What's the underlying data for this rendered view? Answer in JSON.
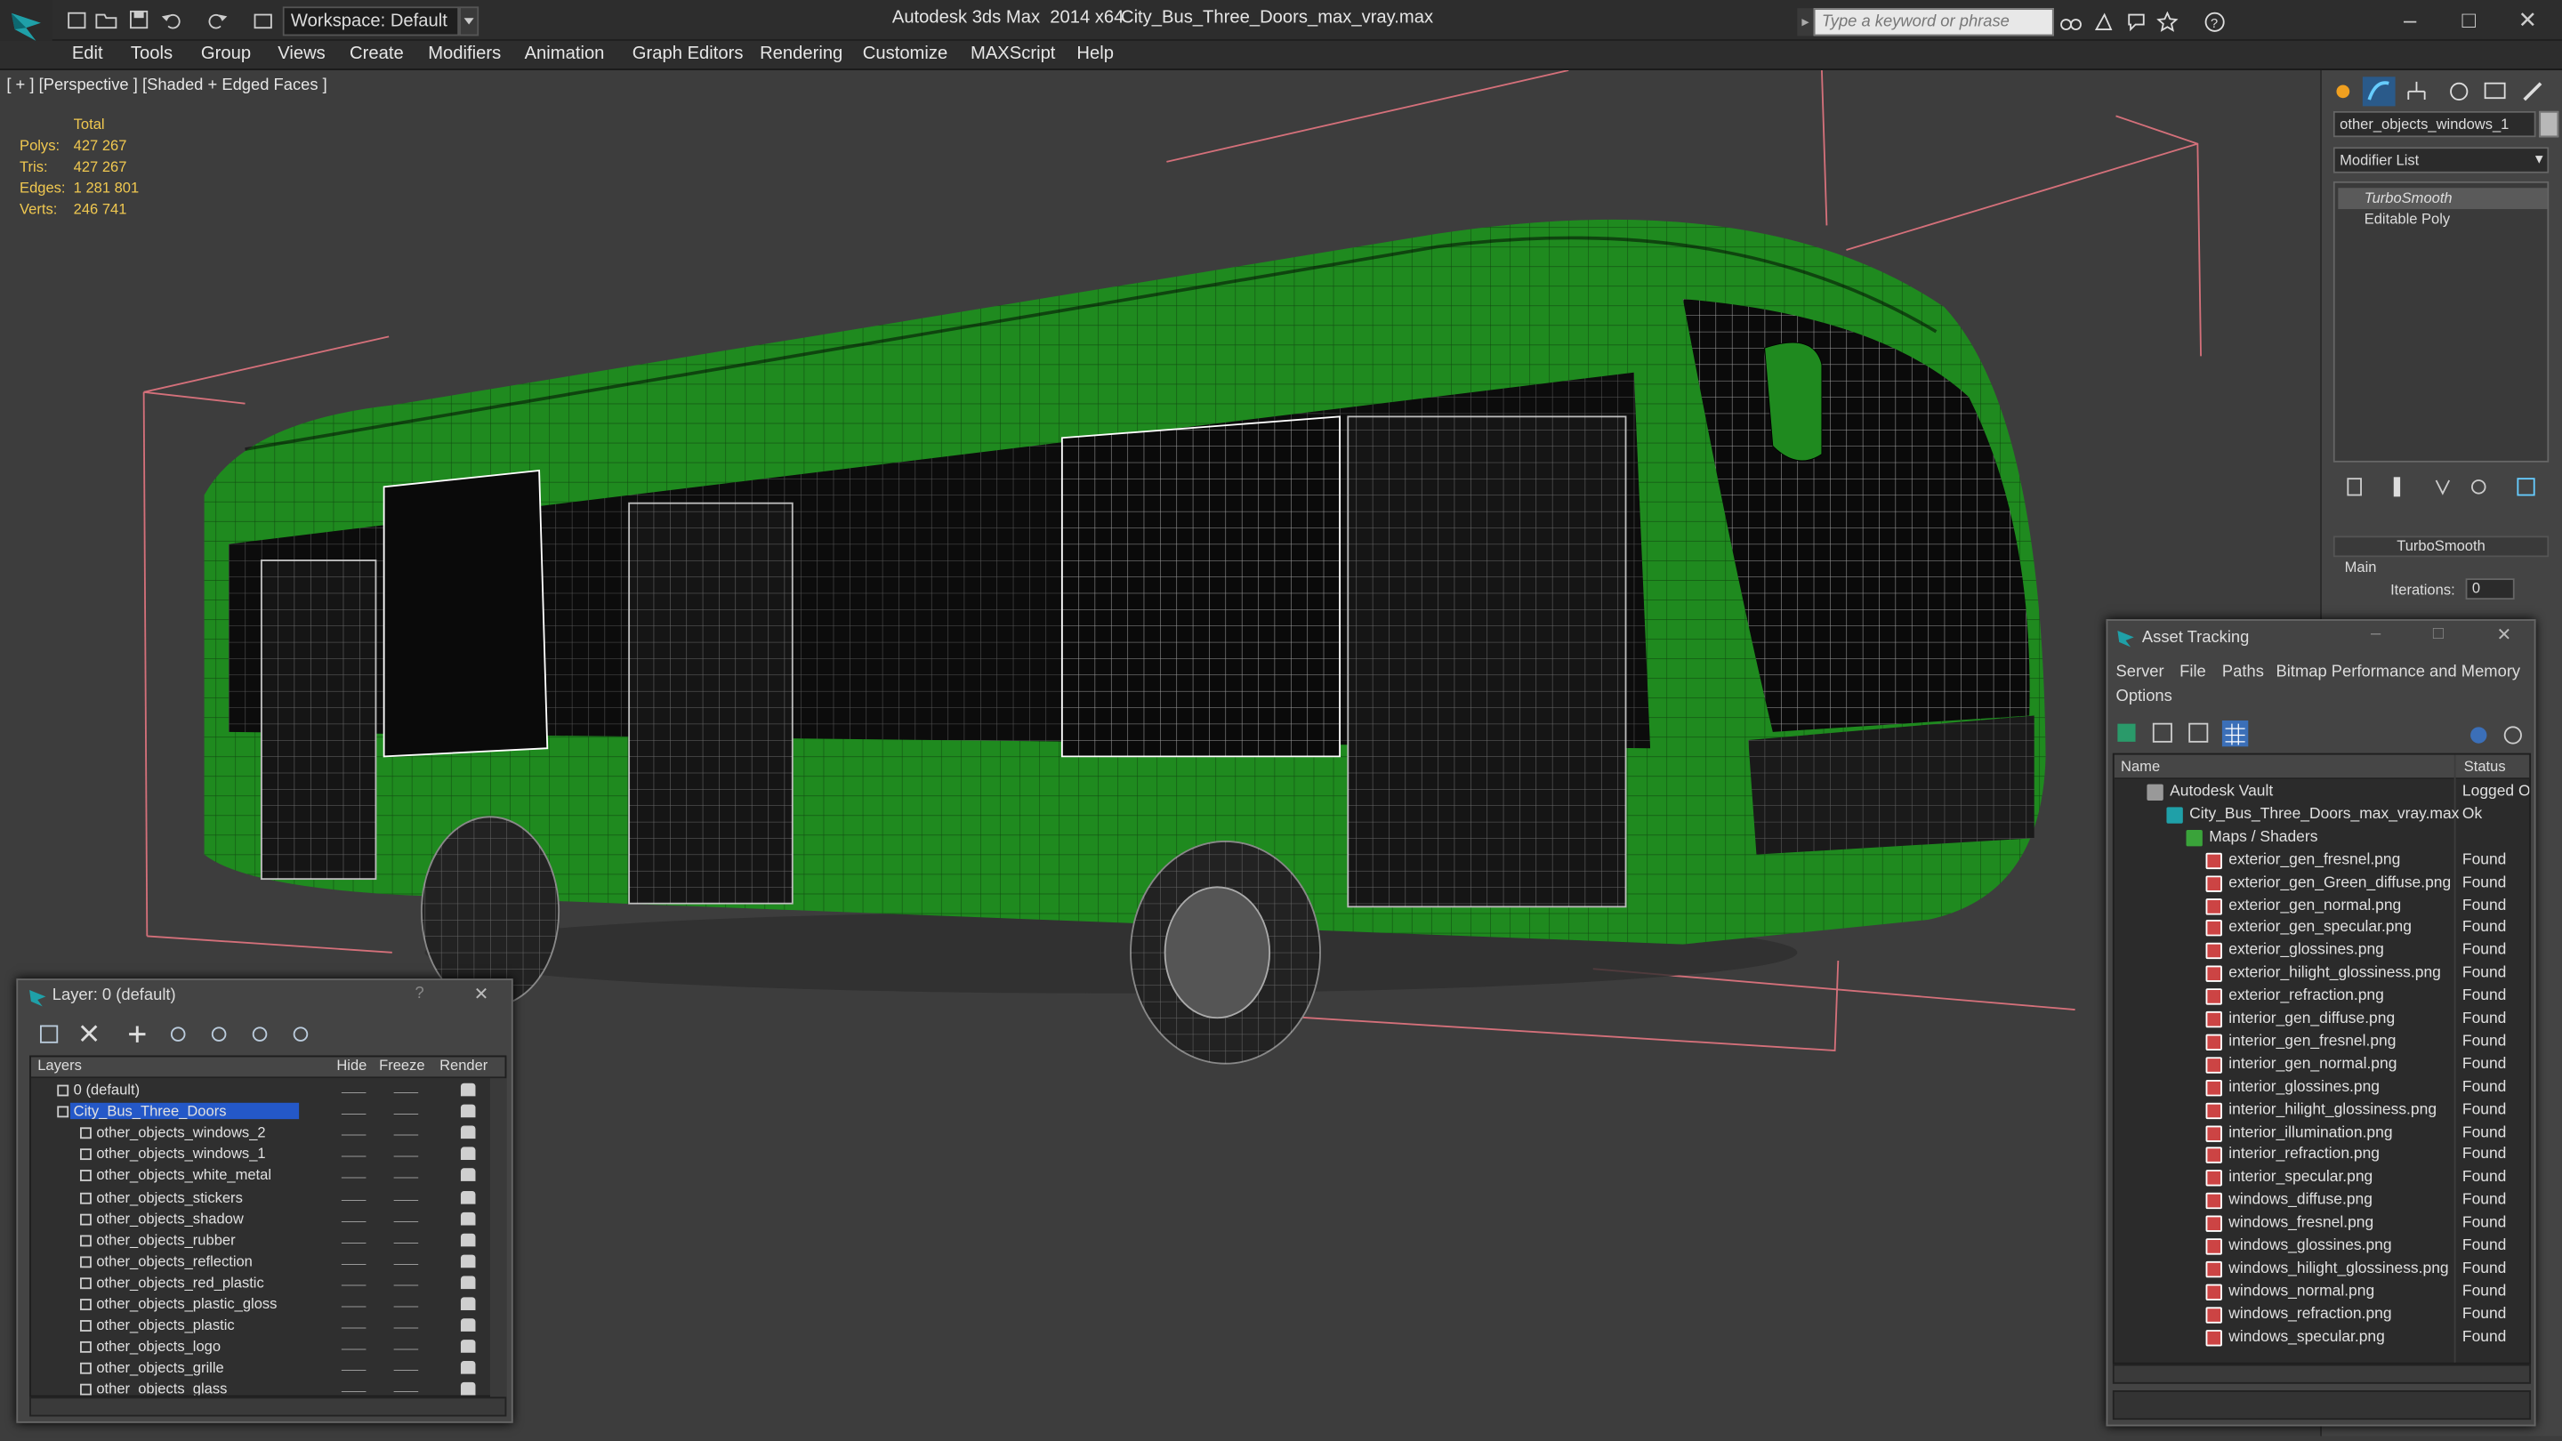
{
  "app": {
    "title": "Autodesk 3ds Max  2014 x64",
    "file": "City_Bus_Three_Doors_max_vray.max",
    "workspace": "Workspace: Default",
    "search_placeholder": "Type a keyword or phrase"
  },
  "menu": [
    "Edit",
    "Tools",
    "Group",
    "Views",
    "Create",
    "Modifiers",
    "Animation",
    "Graph Editors",
    "Rendering",
    "Customize",
    "MAXScript",
    "Help"
  ],
  "viewport": {
    "label": "[ + ] [Perspective ] [Shaded + Edged Faces ]",
    "stats": {
      "header": "Total",
      "rows": [
        {
          "label": "Polys:",
          "value": "427 267"
        },
        {
          "label": "Tris:",
          "value": "427 267"
        },
        {
          "label": "Edges:",
          "value": "1 281 801"
        },
        {
          "label": "Verts:",
          "value": "246 741"
        }
      ]
    }
  },
  "command_panel": {
    "object_name": "other_objects_windows_1",
    "modifier_list": "Modifier List",
    "stack": [
      "TurboSmooth",
      "Editable Poly"
    ],
    "rollout_title": "TurboSmooth",
    "main_label": "Main",
    "iterations_label": "Iterations:",
    "iterations_value": "0"
  },
  "asset_tracking": {
    "title": "Asset Tracking",
    "menu": [
      "Server",
      "File",
      "Paths",
      "Bitmap Performance and Memory"
    ],
    "options": "Options",
    "columns": {
      "name": "Name",
      "status": "Status"
    },
    "rows": [
      {
        "name": "Autodesk Vault",
        "status": "Logged O",
        "indent": 1,
        "icon": "vault"
      },
      {
        "name": "City_Bus_Three_Doors_max_vray.max",
        "status": "Ok",
        "indent": 2,
        "icon": "max"
      },
      {
        "name": "Maps / Shaders",
        "status": "",
        "indent": 3,
        "icon": "folder"
      },
      {
        "name": "exterior_gen_fresnel.png",
        "status": "Found",
        "indent": 4,
        "icon": "png"
      },
      {
        "name": "exterior_gen_Green_diffuse.png",
        "status": "Found",
        "indent": 4,
        "icon": "png"
      },
      {
        "name": "exterior_gen_normal.png",
        "status": "Found",
        "indent": 4,
        "icon": "png"
      },
      {
        "name": "exterior_gen_specular.png",
        "status": "Found",
        "indent": 4,
        "icon": "png"
      },
      {
        "name": "exterior_glossines.png",
        "status": "Found",
        "indent": 4,
        "icon": "png"
      },
      {
        "name": "exterior_hilight_glossiness.png",
        "status": "Found",
        "indent": 4,
        "icon": "png"
      },
      {
        "name": "exterior_refraction.png",
        "status": "Found",
        "indent": 4,
        "icon": "png"
      },
      {
        "name": "interior_gen_diffuse.png",
        "status": "Found",
        "indent": 4,
        "icon": "png"
      },
      {
        "name": "interior_gen_fresnel.png",
        "status": "Found",
        "indent": 4,
        "icon": "png"
      },
      {
        "name": "interior_gen_normal.png",
        "status": "Found",
        "indent": 4,
        "icon": "png"
      },
      {
        "name": "interior_glossines.png",
        "status": "Found",
        "indent": 4,
        "icon": "png"
      },
      {
        "name": "interior_hilight_glossiness.png",
        "status": "Found",
        "indent": 4,
        "icon": "png"
      },
      {
        "name": "interior_illumination.png",
        "status": "Found",
        "indent": 4,
        "icon": "png"
      },
      {
        "name": "interior_refraction.png",
        "status": "Found",
        "indent": 4,
        "icon": "png"
      },
      {
        "name": "interior_specular.png",
        "status": "Found",
        "indent": 4,
        "icon": "png"
      },
      {
        "name": "windows_diffuse.png",
        "status": "Found",
        "indent": 4,
        "icon": "png"
      },
      {
        "name": "windows_fresnel.png",
        "status": "Found",
        "indent": 4,
        "icon": "png"
      },
      {
        "name": "windows_glossines.png",
        "status": "Found",
        "indent": 4,
        "icon": "png"
      },
      {
        "name": "windows_hilight_glossiness.png",
        "status": "Found",
        "indent": 4,
        "icon": "png"
      },
      {
        "name": "windows_normal.png",
        "status": "Found",
        "indent": 4,
        "icon": "png"
      },
      {
        "name": "windows_refraction.png",
        "status": "Found",
        "indent": 4,
        "icon": "png"
      },
      {
        "name": "windows_specular.png",
        "status": "Found",
        "indent": 4,
        "icon": "png"
      }
    ]
  },
  "layer_window": {
    "title": "Layer: 0 (default)",
    "help": "?",
    "columns": {
      "layers": "Layers",
      "hide": "Hide",
      "freeze": "Freeze",
      "render": "Render"
    },
    "rows": [
      {
        "name": "0 (default)",
        "indent": 0,
        "selected": false
      },
      {
        "name": "City_Bus_Three_Doors",
        "indent": 0,
        "selected": true
      },
      {
        "name": "other_objects_windows_2",
        "indent": 1,
        "selected": false
      },
      {
        "name": "other_objects_windows_1",
        "indent": 1,
        "selected": false
      },
      {
        "name": "other_objects_white_metal",
        "indent": 1,
        "selected": false
      },
      {
        "name": "other_objects_stickers",
        "indent": 1,
        "selected": false
      },
      {
        "name": "other_objects_shadow",
        "indent": 1,
        "selected": false
      },
      {
        "name": "other_objects_rubber",
        "indent": 1,
        "selected": false
      },
      {
        "name": "other_objects_reflection",
        "indent": 1,
        "selected": false
      },
      {
        "name": "other_objects_red_plastic",
        "indent": 1,
        "selected": false
      },
      {
        "name": "other_objects_plastic_gloss",
        "indent": 1,
        "selected": false
      },
      {
        "name": "other_objects_plastic",
        "indent": 1,
        "selected": false
      },
      {
        "name": "other_objects_logo",
        "indent": 1,
        "selected": false
      },
      {
        "name": "other_objects_grille",
        "indent": 1,
        "selected": false
      },
      {
        "name": "other_objects_glass",
        "indent": 1,
        "selected": false
      }
    ]
  },
  "colors": {
    "bus_green": "#1f8a1f",
    "selection": "#2458c8",
    "stat_yellow": "#f0c850",
    "bbox_pink": "#d4707a"
  }
}
